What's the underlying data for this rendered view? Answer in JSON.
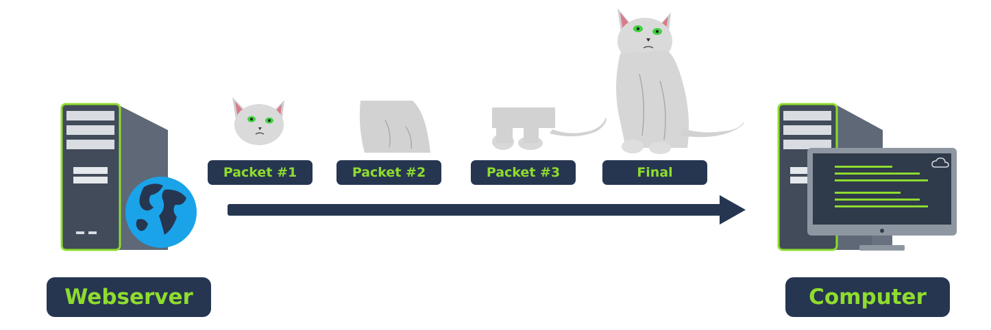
{
  "nodes": {
    "source": {
      "label": "Webserver"
    },
    "destination": {
      "label": "Computer"
    }
  },
  "packets": [
    {
      "label": "Packet #1",
      "content": "cat-head"
    },
    {
      "label": "Packet #2",
      "content": "cat-body"
    },
    {
      "label": "Packet #3",
      "content": "cat-legs-tail"
    },
    {
      "label": "Final",
      "content": "cat-full"
    }
  ],
  "colors": {
    "label_bg": "#263651",
    "label_text": "#8fdc2e",
    "arrow": "#263651",
    "server_body": "#3d4a5c",
    "accent_green": "#8fdc2e",
    "globe_blue": "#1aa3e8"
  },
  "icons": [
    "server-icon",
    "globe-icon",
    "monitor-icon",
    "cloud-icon",
    "cat-image"
  ]
}
